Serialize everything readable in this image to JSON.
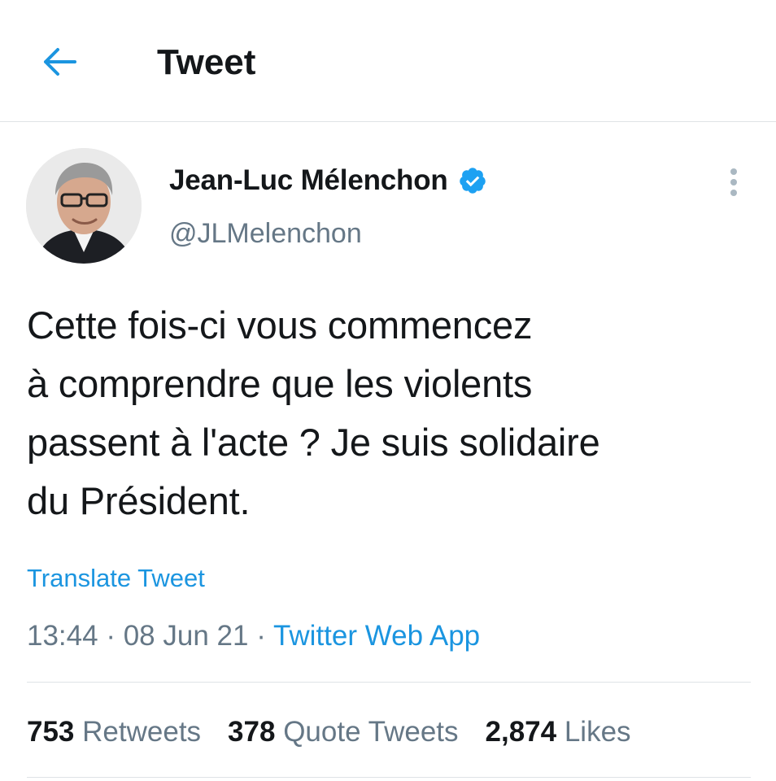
{
  "header": {
    "back_icon": "arrow-left-icon",
    "title": "Tweet"
  },
  "tweet": {
    "author": {
      "display_name": "Jean-Luc Mélenchon",
      "handle": "@JLMelenchon",
      "verified": true,
      "verified_icon": "verified-badge-icon"
    },
    "more_icon": "more-vertical-icon",
    "text": "Cette fois-ci vous commencez\nà comprendre que les violents\npassent à l'acte ? Je suis solidaire\ndu Président.",
    "translate_label": "Translate Tweet",
    "time": "13:44",
    "separator": "·",
    "date": "08 Jun 21",
    "source": "Twitter Web App",
    "stats": {
      "retweets_count": "753",
      "retweets_label": "Retweets",
      "quotes_count": "378",
      "quotes_label": "Quote Tweets",
      "likes_count": "2,874",
      "likes_label": "Likes"
    }
  },
  "colors": {
    "accent": "#1b95e0",
    "text_primary": "#14171a",
    "text_secondary": "#657786",
    "divider": "#dfe3e6"
  }
}
